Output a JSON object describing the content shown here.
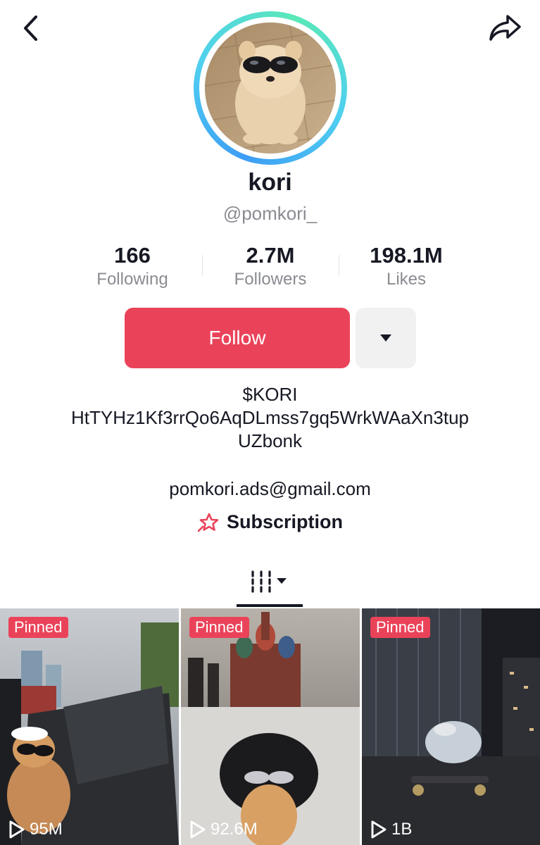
{
  "header": {
    "back_icon": "chevron-left-icon",
    "share_icon": "share-arrow-icon"
  },
  "profile": {
    "display_name": "kori",
    "username": "@pomkori_",
    "avatar_ring_colors": [
      "#3d9df5",
      "#5ae8b8"
    ]
  },
  "stats": [
    {
      "value": "166",
      "label": "Following"
    },
    {
      "value": "2.7M",
      "label": "Followers"
    },
    {
      "value": "198.1M",
      "label": "Likes"
    }
  ],
  "actions": {
    "follow_label": "Follow",
    "more_icon": "caret-down-icon",
    "follow_color": "#ea4359"
  },
  "bio": {
    "lines": [
      "$KORI",
      "HtTYHz1Kf3rrQo6AqDLmss7gq5WrkWAaXn3tup",
      "UZbonk"
    ],
    "email": "pomkori.ads@gmail.com"
  },
  "subscription": {
    "label": "Subscription",
    "icon": "star-rocket-icon"
  },
  "tabs": {
    "active_icon": "grid-videos-icon"
  },
  "videos": [
    {
      "badge": "Pinned",
      "views": "95M"
    },
    {
      "badge": "Pinned",
      "views": "92.6M"
    },
    {
      "badge": "Pinned",
      "views": "1B"
    }
  ]
}
